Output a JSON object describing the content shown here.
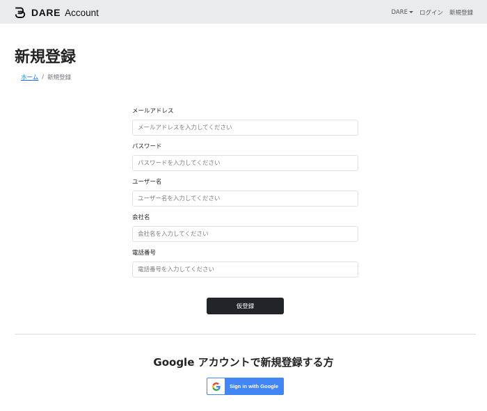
{
  "header": {
    "brand_name": "DARE",
    "brand_suffix": "Account",
    "nav": {
      "dare_menu": "DARE",
      "login": "ログイン",
      "signup": "新規登録"
    }
  },
  "page": {
    "title": "新規登録",
    "breadcrumb": {
      "home": "ホーム",
      "separator": "/",
      "current": "新規登録"
    }
  },
  "form": {
    "fields": [
      {
        "label": "メールアドレス",
        "placeholder": "メールアドレスを入力してください",
        "value": ""
      },
      {
        "label": "パスワード",
        "placeholder": "パスワードを入力してください",
        "value": ""
      },
      {
        "label": "ユーザー名",
        "placeholder": "ユーザー名を入力してください",
        "value": ""
      },
      {
        "label": "会社名",
        "placeholder": "会社名を入力してください",
        "value": ""
      },
      {
        "label": "電話番号",
        "placeholder": "電話番号を入力してください",
        "value": ""
      }
    ],
    "submit_label": "仮登録"
  },
  "google": {
    "heading": "Google アカウントで新規登録する方",
    "button_label": "Sign in with Google",
    "icon": "google-g-icon"
  },
  "colors": {
    "navbar_bg": "#e9ecef",
    "link": "#0d6efd",
    "primary_dark": "#212529",
    "google_blue": "#4285f4"
  }
}
